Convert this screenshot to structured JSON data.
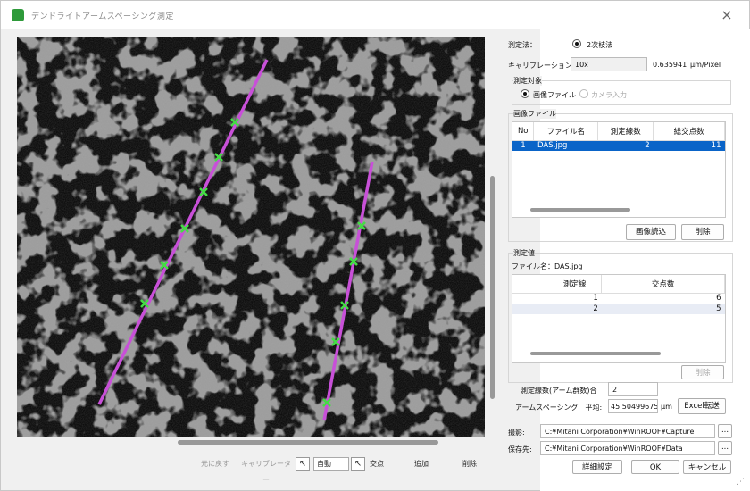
{
  "window": {
    "title": "デンドライトアームスペーシング測定",
    "close_glyph": "×"
  },
  "toolbar": {
    "btn1": "元に戻す",
    "btn2": "キャリブレーター",
    "select_value": "自動",
    "label_intersect": "交点",
    "btn_add": "追加",
    "btn_delete": "削除"
  },
  "measure": {
    "method_label": "測定法：",
    "method_value": "2次枝法",
    "calib_label": "キャリブレーション：",
    "calib_value": "10x",
    "calib_number": "0.635941",
    "calib_unit": "μm/Pixel"
  },
  "target": {
    "group_label": "測定対象",
    "opt_file": "画像ファイル",
    "opt_camera": "カメラ入力"
  },
  "image_files": {
    "group_label": "画像ファイル",
    "columns": [
      "No",
      "ファイル名",
      "測定線数",
      "総交点数"
    ],
    "rows": [
      {
        "no": "1",
        "name": "DAS.jpg",
        "lines": "2",
        "points": "11"
      }
    ],
    "btn_load": "画像読込",
    "btn_delete": "削除"
  },
  "results": {
    "group_label": "測定値",
    "file_label": "ファイル名：DAS.jpg",
    "columns": [
      "測定線",
      "交点数"
    ],
    "rows": [
      {
        "line": "1",
        "points": "6"
      },
      {
        "line": "2",
        "points": "5"
      }
    ],
    "btn_delete": "削除",
    "line_count_label": "測定線数(アーム群数)合",
    "line_count_value": "2",
    "spacing_label": "アームスペーシング　平均:",
    "spacing_value": "45.504996751",
    "spacing_unit": "μm",
    "btn_excel": "Excel転送"
  },
  "paths": {
    "capture_label": "撮影:",
    "capture_value": "C:¥Mitani Corporation¥WinROOF¥Capture",
    "save_label": "保存先:",
    "save_value": "C:¥Mitani Corporation¥WinROOF¥Data",
    "browse": "..."
  },
  "footer": {
    "btn_detail": "詳細設定",
    "btn_ok": "OK",
    "btn_cancel": "キャンセル"
  },
  "colors": {
    "measure_line": "#c850d8",
    "intersect_marker": "#44dd44",
    "selection": "#0a64c8"
  }
}
